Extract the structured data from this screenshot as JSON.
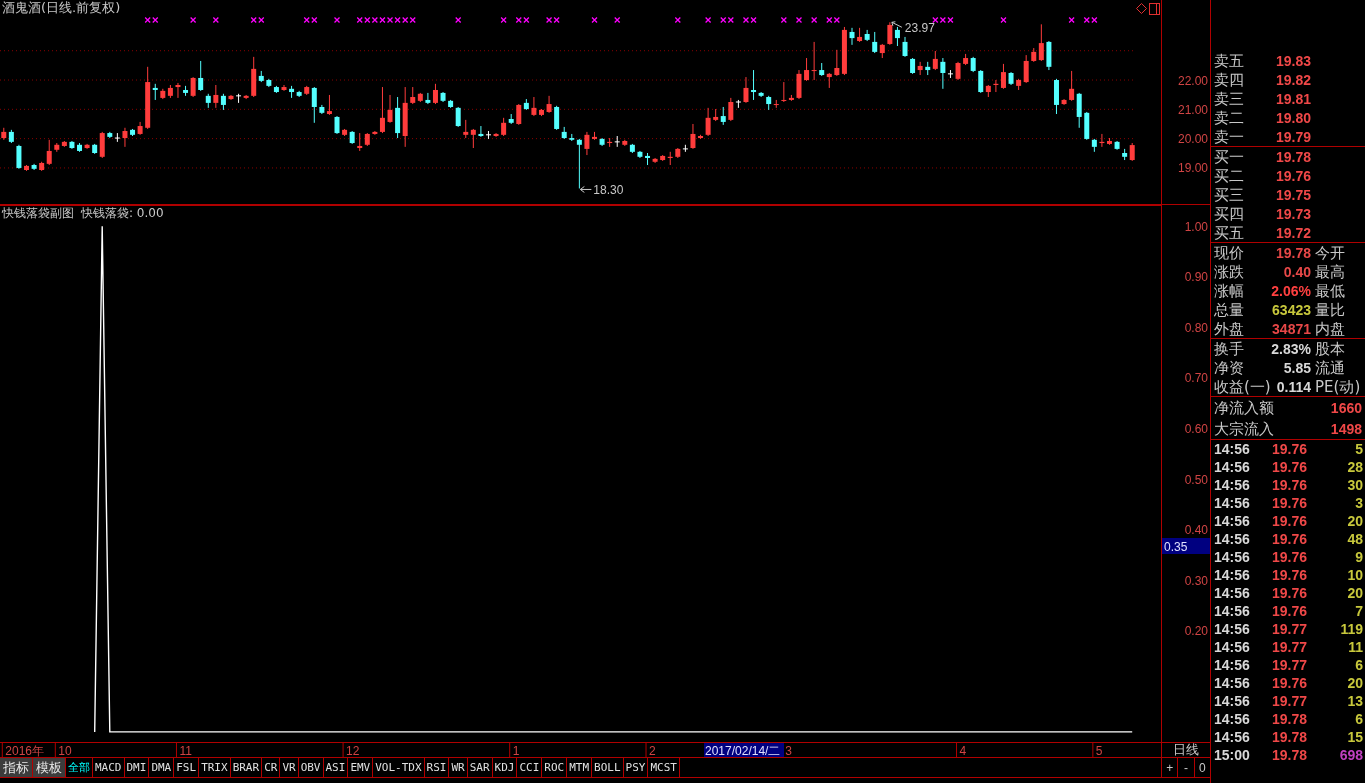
{
  "chart_header": {
    "title": "酒鬼酒(日线.前复权)"
  },
  "candle_chart": {
    "high_price": "23.97",
    "low_price": "18.30",
    "chart_data": {
      "type": "candlestick",
      "grid": true,
      "ylim": [
        17.77,
        24.73
      ],
      "yticks": [
        {
          "value": 19,
          "label": "19.00"
        },
        {
          "value": 20,
          "label": "20.00"
        },
        {
          "value": 21,
          "label": "21.00"
        },
        {
          "value": 22,
          "label": "22.00"
        }
      ],
      "ohlc": [
        [
          20.02,
          20.37,
          19.96,
          20.23
        ],
        [
          20.23,
          20.3,
          19.85,
          19.89
        ],
        [
          19.75,
          19.79,
          18.97,
          19.0
        ],
        [
          18.93,
          19.1,
          18.9,
          19.07
        ],
        [
          19.1,
          19.14,
          18.93,
          18.97
        ],
        [
          18.93,
          19.21,
          18.9,
          19.17
        ],
        [
          19.14,
          19.96,
          19.1,
          19.58
        ],
        [
          19.62,
          19.85,
          19.55,
          19.79
        ],
        [
          19.75,
          19.92,
          19.72,
          19.89
        ],
        [
          19.89,
          19.92,
          19.65,
          19.68
        ],
        [
          19.79,
          19.85,
          19.55,
          19.58
        ],
        [
          19.68,
          19.82,
          19.65,
          19.79
        ],
        [
          19.79,
          19.82,
          19.48,
          19.51
        ],
        [
          19.38,
          20.23,
          19.34,
          20.19
        ],
        [
          20.19,
          20.23,
          20.02,
          20.06
        ],
        [
          20.02,
          20.19,
          19.89,
          20.02
        ],
        [
          20.02,
          20.37,
          19.72,
          20.26
        ],
        [
          20.3,
          20.33,
          20.09,
          20.13
        ],
        [
          20.16,
          20.57,
          20.13,
          20.43
        ],
        [
          20.37,
          22.45,
          20.33,
          21.93
        ],
        [
          21.73,
          21.87,
          21.32,
          21.66
        ],
        [
          21.39,
          21.7,
          21.35,
          21.63
        ],
        [
          21.46,
          21.83,
          21.39,
          21.73
        ],
        [
          21.76,
          21.9,
          21.39,
          21.83
        ],
        [
          21.66,
          21.8,
          21.46,
          21.56
        ],
        [
          21.46,
          22.1,
          21.42,
          22.07
        ],
        [
          22.07,
          22.65,
          21.63,
          21.66
        ],
        [
          21.46,
          21.53,
          21.05,
          21.22
        ],
        [
          21.22,
          21.83,
          21.05,
          21.49
        ],
        [
          21.46,
          21.53,
          20.98,
          21.15
        ],
        [
          21.35,
          21.49,
          21.32,
          21.46
        ],
        [
          21.46,
          21.53,
          21.22,
          21.46
        ],
        [
          21.39,
          21.49,
          21.35,
          21.46
        ],
        [
          21.46,
          22.79,
          21.42,
          22.38
        ],
        [
          22.14,
          22.31,
          21.93,
          21.97
        ],
        [
          22.0,
          22.04,
          21.76,
          21.8
        ],
        [
          21.76,
          21.8,
          21.56,
          21.59
        ],
        [
          21.66,
          21.83,
          21.63,
          21.76
        ],
        [
          21.7,
          21.8,
          21.39,
          21.59
        ],
        [
          21.59,
          21.63,
          21.42,
          21.46
        ],
        [
          21.53,
          21.8,
          21.49,
          21.76
        ],
        [
          21.73,
          21.76,
          20.54,
          21.08
        ],
        [
          21.08,
          21.15,
          20.84,
          20.88
        ],
        [
          20.84,
          21.49,
          20.81,
          20.94
        ],
        [
          20.74,
          20.77,
          20.16,
          20.19
        ],
        [
          20.13,
          20.33,
          20.09,
          20.3
        ],
        [
          20.23,
          20.26,
          19.82,
          19.85
        ],
        [
          19.68,
          20.19,
          19.58,
          19.75
        ],
        [
          19.79,
          20.19,
          19.75,
          20.16
        ],
        [
          20.16,
          20.26,
          20.13,
          20.23
        ],
        [
          20.23,
          21.76,
          20.19,
          20.71
        ],
        [
          20.57,
          21.49,
          20.54,
          20.98
        ],
        [
          21.05,
          21.42,
          20.02,
          20.19
        ],
        [
          20.09,
          21.76,
          19.72,
          21.22
        ],
        [
          21.22,
          21.76,
          21.18,
          21.42
        ],
        [
          21.29,
          21.56,
          21.25,
          21.53
        ],
        [
          21.32,
          21.56,
          21.18,
          21.22
        ],
        [
          21.22,
          21.87,
          21.18,
          21.66
        ],
        [
          21.56,
          21.59,
          21.25,
          21.29
        ],
        [
          21.29,
          21.32,
          21.05,
          21.08
        ],
        [
          21.05,
          21.08,
          20.4,
          20.43
        ],
        [
          20.13,
          20.64,
          20.02,
          20.23
        ],
        [
          20.13,
          20.33,
          19.68,
          20.3
        ],
        [
          20.16,
          20.43,
          20.06,
          20.09
        ],
        [
          20.13,
          20.26,
          19.99,
          20.13
        ],
        [
          20.09,
          20.19,
          20.06,
          20.16
        ],
        [
          20.13,
          20.71,
          20.09,
          20.54
        ],
        [
          20.67,
          20.84,
          20.5,
          20.54
        ],
        [
          20.5,
          21.18,
          20.47,
          21.15
        ],
        [
          21.22,
          21.35,
          20.98,
          21.01
        ],
        [
          20.81,
          21.42,
          20.77,
          21.05
        ],
        [
          20.81,
          21.01,
          20.77,
          20.98
        ],
        [
          20.91,
          21.46,
          20.88,
          21.18
        ],
        [
          21.08,
          21.12,
          20.3,
          20.33
        ],
        [
          20.23,
          20.4,
          19.99,
          20.02
        ],
        [
          20.02,
          20.16,
          19.92,
          19.96
        ],
        [
          19.96,
          19.99,
          18.3,
          19.79
        ],
        [
          19.65,
          20.23,
          19.44,
          20.13
        ],
        [
          19.99,
          20.23,
          19.96,
          20.06
        ],
        [
          19.99,
          20.02,
          19.75,
          19.79
        ],
        [
          19.85,
          20.02,
          19.72,
          19.89
        ],
        [
          19.89,
          20.09,
          19.72,
          19.89
        ],
        [
          19.79,
          19.96,
          19.75,
          19.92
        ],
        [
          19.79,
          19.82,
          19.51,
          19.55
        ],
        [
          19.55,
          19.58,
          19.34,
          19.38
        ],
        [
          19.41,
          19.51,
          19.1,
          19.34
        ],
        [
          19.21,
          19.34,
          19.17,
          19.31
        ],
        [
          19.27,
          19.44,
          19.24,
          19.41
        ],
        [
          19.34,
          19.55,
          19.1,
          19.38
        ],
        [
          19.38,
          19.68,
          19.34,
          19.65
        ],
        [
          19.65,
          19.79,
          19.55,
          19.65
        ],
        [
          19.68,
          20.5,
          19.65,
          20.16
        ],
        [
          20.02,
          20.13,
          19.99,
          20.09
        ],
        [
          20.13,
          21.05,
          20.09,
          20.71
        ],
        [
          20.64,
          21.01,
          20.6,
          20.74
        ],
        [
          20.77,
          21.08,
          20.47,
          20.57
        ],
        [
          20.64,
          21.39,
          20.6,
          21.25
        ],
        [
          21.25,
          21.32,
          21.05,
          21.25
        ],
        [
          21.25,
          22.1,
          21.22,
          21.73
        ],
        [
          21.66,
          22.34,
          21.32,
          21.59
        ],
        [
          21.56,
          21.59,
          21.42,
          21.46
        ],
        [
          21.42,
          21.46,
          20.98,
          21.18
        ],
        [
          21.15,
          21.32,
          21.05,
          21.18
        ],
        [
          21.29,
          21.93,
          21.25,
          21.32
        ],
        [
          21.32,
          21.49,
          21.29,
          21.39
        ],
        [
          21.39,
          22.34,
          21.35,
          22.21
        ],
        [
          22.0,
          22.75,
          21.97,
          22.34
        ],
        [
          22.31,
          23.3,
          22.0,
          22.34
        ],
        [
          22.34,
          22.58,
          22.14,
          22.17
        ],
        [
          22.1,
          22.24,
          21.73,
          22.21
        ],
        [
          22.17,
          23.03,
          22.14,
          22.41
        ],
        [
          22.21,
          23.81,
          22.17,
          23.71
        ],
        [
          23.64,
          23.78,
          23.2,
          23.43
        ],
        [
          23.33,
          23.78,
          23.3,
          23.47
        ],
        [
          23.57,
          23.71,
          23.33,
          23.37
        ],
        [
          23.3,
          23.64,
          22.92,
          22.96
        ],
        [
          22.92,
          23.23,
          22.75,
          23.2
        ],
        [
          23.23,
          23.97,
          23.2,
          23.88
        ],
        [
          23.71,
          23.81,
          23.16,
          23.43
        ],
        [
          23.3,
          23.47,
          22.79,
          22.82
        ],
        [
          22.72,
          22.75,
          22.21,
          22.24
        ],
        [
          22.34,
          22.62,
          22.17,
          22.48
        ],
        [
          22.45,
          22.62,
          22.17,
          22.34
        ],
        [
          22.38,
          22.99,
          22.34,
          22.72
        ],
        [
          22.62,
          22.75,
          21.7,
          22.24
        ],
        [
          22.21,
          22.34,
          22.07,
          22.21
        ],
        [
          22.04,
          22.62,
          22.0,
          22.58
        ],
        [
          22.55,
          22.89,
          22.51,
          22.75
        ],
        [
          22.75,
          22.79,
          22.27,
          22.31
        ],
        [
          22.31,
          22.34,
          21.56,
          21.59
        ],
        [
          21.59,
          21.83,
          21.42,
          21.8
        ],
        [
          21.83,
          22.0,
          21.59,
          21.87
        ],
        [
          21.73,
          22.55,
          21.7,
          22.27
        ],
        [
          22.24,
          22.27,
          21.83,
          21.87
        ],
        [
          21.8,
          22.04,
          21.66,
          22.0
        ],
        [
          21.93,
          22.85,
          21.9,
          22.65
        ],
        [
          22.65,
          23.09,
          22.62,
          22.96
        ],
        [
          22.68,
          23.9,
          22.65,
          23.26
        ],
        [
          23.3,
          23.33,
          22.34,
          22.45
        ],
        [
          22.0,
          22.04,
          20.84,
          21.15
        ],
        [
          21.18,
          21.35,
          21.15,
          21.32
        ],
        [
          21.32,
          22.31,
          21.29,
          21.7
        ],
        [
          21.53,
          21.56,
          20.37,
          20.74
        ],
        [
          20.88,
          20.91,
          19.96,
          19.99
        ],
        [
          19.96,
          19.99,
          19.55,
          19.72
        ],
        [
          19.85,
          20.16,
          19.72,
          19.89
        ],
        [
          19.82,
          20.02,
          19.79,
          19.92
        ],
        [
          19.89,
          19.92,
          19.62,
          19.65
        ],
        [
          19.51,
          19.65,
          19.27,
          19.38
        ],
        [
          19.27,
          19.85,
          19.24,
          19.78
        ]
      ]
    }
  },
  "indicator_panel": {
    "title": "快钱落袋副图",
    "reading": ": 0.00",
    "cursor_value": "0.35",
    "chart_data": {
      "type": "line",
      "ylim": [
        -0.02,
        1.04
      ],
      "yticks": [
        {
          "value": 0.2,
          "label": "0.20"
        },
        {
          "value": 0.3,
          "label": "0.30"
        },
        {
          "value": 0.4,
          "label": "0.40"
        },
        {
          "value": 0.5,
          "label": "0.50"
        },
        {
          "value": 0.6,
          "label": "0.60"
        },
        {
          "value": 0.7,
          "label": "0.70"
        },
        {
          "value": 0.8,
          "label": "0.80"
        },
        {
          "value": 0.9,
          "label": "0.90"
        },
        {
          "value": 1.0,
          "label": "1.00"
        }
      ],
      "series": [
        {
          "name": "快钱落袋",
          "color": "#ffffff",
          "values": [
            null,
            null,
            null,
            null,
            null,
            null,
            null,
            null,
            null,
            null,
            null,
            null,
            0,
            1,
            0,
            0,
            0,
            0,
            0,
            0,
            0,
            0,
            0,
            0,
            0,
            0,
            0,
            0,
            0,
            0,
            0,
            0,
            0,
            0,
            0,
            0,
            0,
            0,
            0,
            0,
            0,
            0,
            0,
            0,
            0,
            0,
            0,
            0,
            0,
            0,
            0,
            0,
            0,
            0,
            0,
            0,
            0,
            0,
            0,
            0,
            0,
            0,
            0,
            0,
            0,
            0,
            0,
            0,
            0,
            0,
            0,
            0,
            0,
            0,
            0,
            0,
            0,
            0,
            0,
            0,
            0,
            0,
            0,
            0,
            0,
            0,
            0,
            0,
            0,
            0,
            0,
            0,
            0,
            0,
            0,
            0,
            0,
            0,
            0,
            0,
            0,
            0,
            0,
            0,
            0,
            0,
            0,
            0,
            0,
            0,
            0,
            0,
            0,
            0,
            0,
            0,
            0,
            0,
            0,
            0,
            0,
            0,
            0,
            0,
            0,
            0,
            0,
            0,
            0,
            0,
            0,
            0,
            0,
            0,
            0,
            0,
            0,
            0,
            0,
            0,
            0,
            0,
            0,
            0,
            0,
            0,
            0,
            0,
            0,
            0
          ]
        }
      ]
    }
  },
  "date_axis": {
    "labels": [
      "2016年",
      "10",
      "11",
      "12",
      "1",
      "2",
      "3",
      "4",
      "5"
    ],
    "cursor_date": "2017/02/14/二",
    "period": "日线"
  },
  "toolbar": {
    "menus": [
      {
        "label": "指标"
      },
      {
        "label": "模板"
      }
    ],
    "tabs": [
      {
        "label": "全部",
        "selected": true
      },
      {
        "label": "MACD",
        "selected": false
      },
      {
        "label": "DMI",
        "selected": false
      },
      {
        "label": "DMA",
        "selected": false
      },
      {
        "label": "FSL",
        "selected": false
      },
      {
        "label": "TRIX",
        "selected": false
      },
      {
        "label": "BRAR",
        "selected": false
      },
      {
        "label": "CR",
        "selected": false
      },
      {
        "label": "VR",
        "selected": false
      },
      {
        "label": "OBV",
        "selected": false
      },
      {
        "label": "ASI",
        "selected": false
      },
      {
        "label": "EMV",
        "selected": false
      },
      {
        "label": "VOL-TDX",
        "selected": false
      },
      {
        "label": "RSI",
        "selected": false
      },
      {
        "label": "WR",
        "selected": false
      },
      {
        "label": "SAR",
        "selected": false
      },
      {
        "label": "KDJ",
        "selected": false
      },
      {
        "label": "CCI",
        "selected": false
      },
      {
        "label": "ROC",
        "selected": false
      },
      {
        "label": "MTM",
        "selected": false
      },
      {
        "label": "BOLL",
        "selected": false
      },
      {
        "label": "PSY",
        "selected": false
      },
      {
        "label": "MCST",
        "selected": false
      }
    ],
    "zoom_buttons": [
      {
        "label": "+"
      },
      {
        "label": "-"
      },
      {
        "label": "0"
      }
    ]
  },
  "quote_panel": {
    "asks": [
      {
        "label": "卖五",
        "price": "19.83"
      },
      {
        "label": "卖四",
        "price": "19.82"
      },
      {
        "label": "卖三",
        "price": "19.81"
      },
      {
        "label": "卖二",
        "price": "19.80"
      },
      {
        "label": "卖一",
        "price": "19.79"
      }
    ],
    "bids": [
      {
        "label": "买一",
        "price": "19.78"
      },
      {
        "label": "买二",
        "price": "19.76"
      },
      {
        "label": "买三",
        "price": "19.75"
      },
      {
        "label": "买四",
        "price": "19.73"
      },
      {
        "label": "买五",
        "price": "19.72"
      }
    ],
    "stats": [
      {
        "label": "现价",
        "value": "19.78",
        "color": "#e84848",
        "side_label": "今开"
      },
      {
        "label": "涨跌",
        "value": "0.40",
        "color": "#e84848",
        "side_label": "最高"
      },
      {
        "label": "涨幅",
        "value": "2.06%",
        "color": "#ff4040",
        "side_label": "最低"
      },
      {
        "label": "总量",
        "value": "63423",
        "color": "#c8c83c",
        "side_label": "量比"
      },
      {
        "label": "外盘",
        "value": "34871",
        "color": "#e84848",
        "side_label": "内盘"
      }
    ],
    "fundamentals": [
      {
        "label": "换手",
        "value": "2.83%",
        "side_label": "股本"
      },
      {
        "label": "净资",
        "value": "5.85",
        "side_label": "流通"
      },
      {
        "label": "收益(一)",
        "value": "0.114",
        "side_label": "PE(动)"
      }
    ],
    "flows": [
      {
        "label": "净流入额",
        "value": "1660"
      },
      {
        "label": "大宗流入",
        "value": "1498"
      }
    ],
    "ticks": [
      {
        "time": "14:56",
        "price": "19.76",
        "volume": "5",
        "color": "#c8c83c"
      },
      {
        "time": "14:56",
        "price": "19.76",
        "volume": "28",
        "color": "#c8c83c"
      },
      {
        "time": "14:56",
        "price": "19.76",
        "volume": "30",
        "color": "#c8c83c"
      },
      {
        "time": "14:56",
        "price": "19.76",
        "volume": "3",
        "color": "#c8c83c"
      },
      {
        "time": "14:56",
        "price": "19.76",
        "volume": "20",
        "color": "#c8c83c"
      },
      {
        "time": "14:56",
        "price": "19.76",
        "volume": "48",
        "color": "#c8c83c"
      },
      {
        "time": "14:56",
        "price": "19.76",
        "volume": "9",
        "color": "#c8c83c"
      },
      {
        "time": "14:56",
        "price": "19.76",
        "volume": "10",
        "color": "#c8c83c"
      },
      {
        "time": "14:56",
        "price": "19.76",
        "volume": "20",
        "color": "#c8c83c"
      },
      {
        "time": "14:56",
        "price": "19.76",
        "volume": "7",
        "color": "#c8c83c"
      },
      {
        "time": "14:56",
        "price": "19.77",
        "volume": "119",
        "color": "#c8c83c"
      },
      {
        "time": "14:56",
        "price": "19.77",
        "volume": "11",
        "color": "#c8c83c"
      },
      {
        "time": "14:56",
        "price": "19.77",
        "volume": "6",
        "color": "#c8c83c"
      },
      {
        "time": "14:56",
        "price": "19.76",
        "volume": "20",
        "color": "#c8c83c"
      },
      {
        "time": "14:56",
        "price": "19.77",
        "volume": "13",
        "color": "#c8c83c"
      },
      {
        "time": "14:56",
        "price": "19.78",
        "volume": "6",
        "color": "#c8c83c"
      },
      {
        "time": "14:56",
        "price": "19.78",
        "volume": "15",
        "color": "#c8c83c"
      },
      {
        "time": "15:00",
        "price": "19.78",
        "volume": "698",
        "color": "#c040c0"
      }
    ]
  }
}
